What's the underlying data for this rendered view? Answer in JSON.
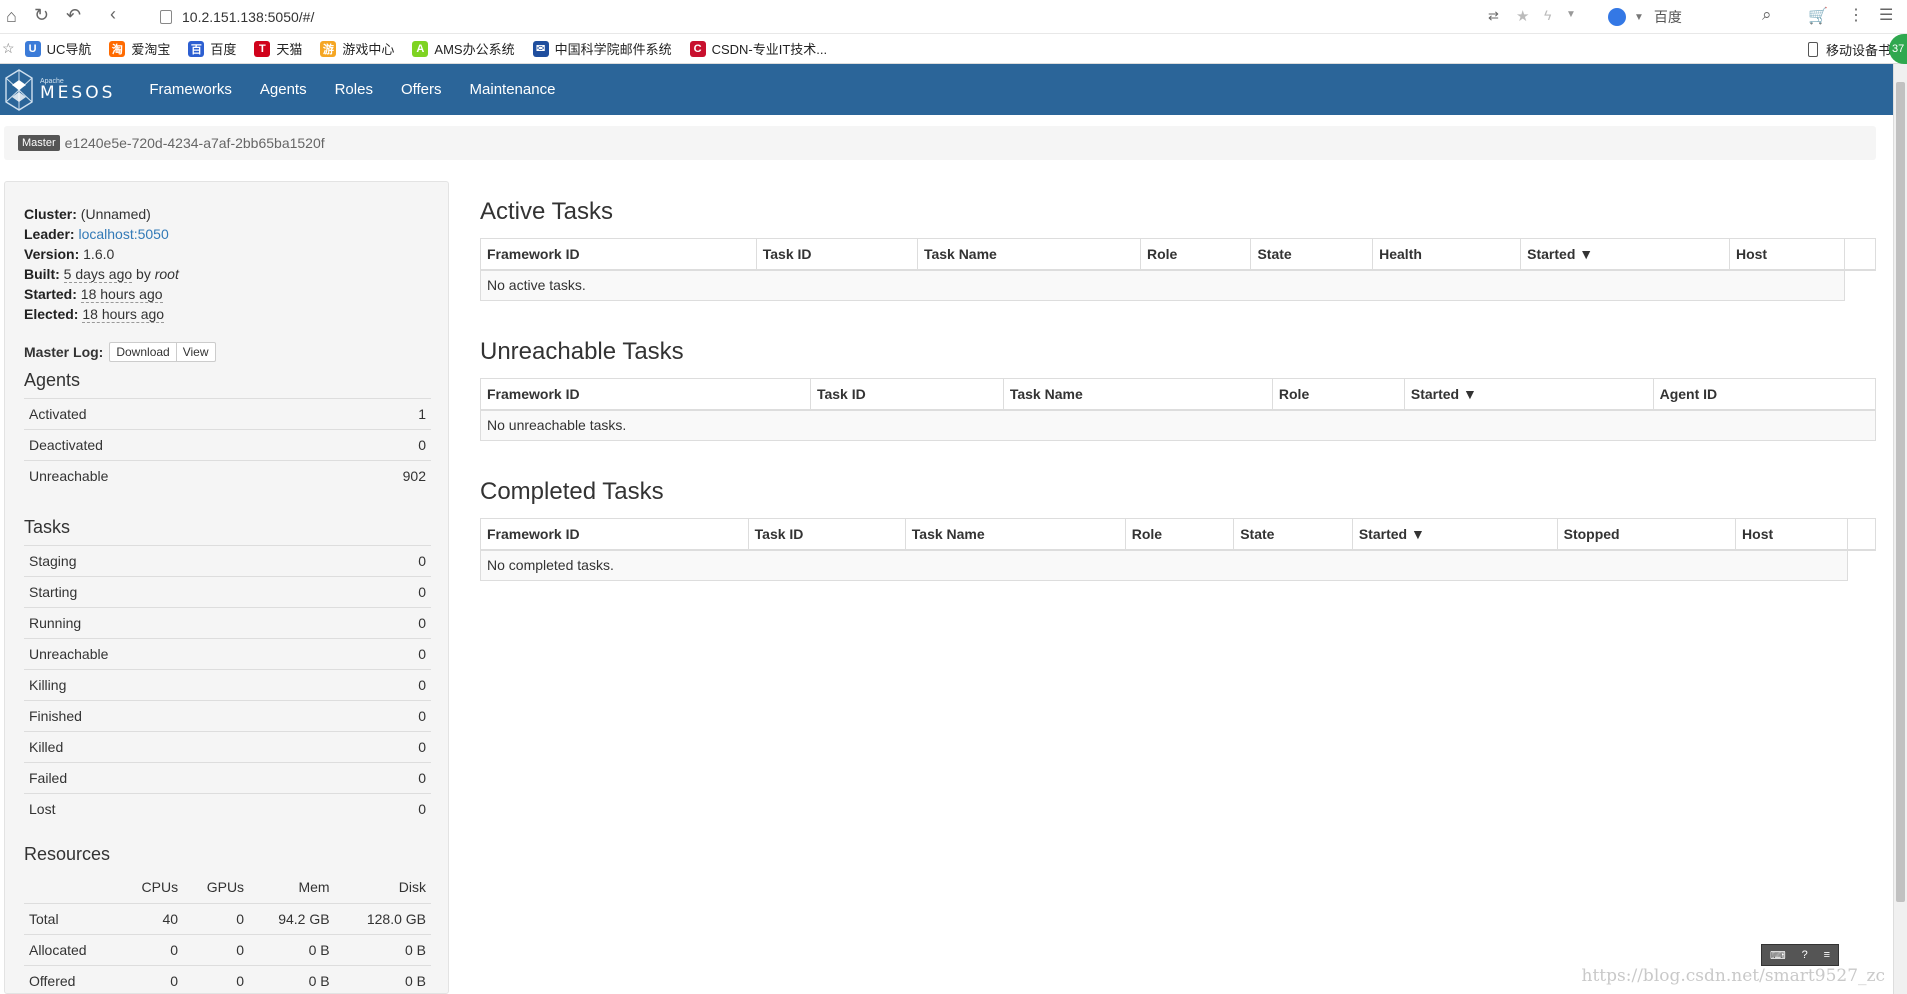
{
  "browser": {
    "url": "10.2.151.138:5050/#/",
    "search_engine": "百度",
    "bookmarks": [
      {
        "label": "UC导航",
        "color": "#3b7bd8",
        "glyph": "U"
      },
      {
        "label": "爱淘宝",
        "color": "#ff6a00",
        "glyph": "淘"
      },
      {
        "label": "百度",
        "color": "#2d5fd1",
        "glyph": "百"
      },
      {
        "label": "天猫",
        "color": "#d0021b",
        "glyph": "T"
      },
      {
        "label": "游戏中心",
        "color": "#f5a623",
        "glyph": "游"
      },
      {
        "label": "AMS办公系统",
        "color": "#7ed321",
        "glyph": "A"
      },
      {
        "label": "中国科学院邮件系统",
        "color": "#1f4e9e",
        "glyph": "✉"
      },
      {
        "label": "CSDN-专业IT技术...",
        "color": "#c8102e",
        "glyph": "C"
      }
    ],
    "mobile_label": "移动设备书",
    "badge": "37"
  },
  "nav": {
    "brand_small": "Apache",
    "brand": "MESOS",
    "links": [
      "Frameworks",
      "Agents",
      "Roles",
      "Offers",
      "Maintenance"
    ]
  },
  "master": {
    "label": "Master",
    "id": "e1240e5e-720d-4234-a7af-2bb65ba1520f"
  },
  "cluster": {
    "cluster_label": "Cluster:",
    "cluster_value": "(Unnamed)",
    "leader_label": "Leader:",
    "leader_value": "localhost:5050",
    "version_label": "Version:",
    "version_value": "1.6.0",
    "built_label": "Built:",
    "built_value": "5 days ago",
    "built_by": "by",
    "built_user": "root",
    "started_label": "Started:",
    "started_value": "18 hours ago",
    "elected_label": "Elected:",
    "elected_value": "18 hours ago",
    "masterlog_label": "Master Log:",
    "download": "Download",
    "view": "View"
  },
  "agents": {
    "title": "Agents",
    "rows": [
      {
        "label": "Activated",
        "value": "1"
      },
      {
        "label": "Deactivated",
        "value": "0"
      },
      {
        "label": "Unreachable",
        "value": "902"
      }
    ]
  },
  "tasks": {
    "title": "Tasks",
    "rows": [
      {
        "label": "Staging",
        "value": "0"
      },
      {
        "label": "Starting",
        "value": "0"
      },
      {
        "label": "Running",
        "value": "0"
      },
      {
        "label": "Unreachable",
        "value": "0"
      },
      {
        "label": "Killing",
        "value": "0"
      },
      {
        "label": "Finished",
        "value": "0"
      },
      {
        "label": "Killed",
        "value": "0"
      },
      {
        "label": "Failed",
        "value": "0"
      },
      {
        "label": "Lost",
        "value": "0"
      }
    ]
  },
  "resources": {
    "title": "Resources",
    "headers": [
      "",
      "CPUs",
      "GPUs",
      "Mem",
      "Disk"
    ],
    "rows": [
      [
        "Total",
        "40",
        "0",
        "94.2 GB",
        "128.0 GB"
      ],
      [
        "Allocated",
        "0",
        "0",
        "0 B",
        "0 B"
      ],
      [
        "Offered",
        "0",
        "0",
        "0 B",
        "0 B"
      ]
    ]
  },
  "active_tasks": {
    "title": "Active Tasks",
    "headers": [
      "Framework ID",
      "Task ID",
      "Task Name",
      "Role",
      "State",
      "Health",
      "Started ▼",
      "Host",
      ""
    ],
    "empty": "No active tasks."
  },
  "unreachable_tasks": {
    "title": "Unreachable Tasks",
    "headers": [
      "Framework ID",
      "Task ID",
      "Task Name",
      "Role",
      "Started ▼",
      "Agent ID"
    ],
    "empty": "No unreachable tasks."
  },
  "completed_tasks": {
    "title": "Completed Tasks",
    "headers": [
      "Framework ID",
      "Task ID",
      "Task Name",
      "Role",
      "State",
      "Started ▼",
      "Stopped",
      "Host",
      ""
    ],
    "empty": "No completed tasks."
  },
  "watermark": "https://blog.csdn.net/smart9527_zc"
}
